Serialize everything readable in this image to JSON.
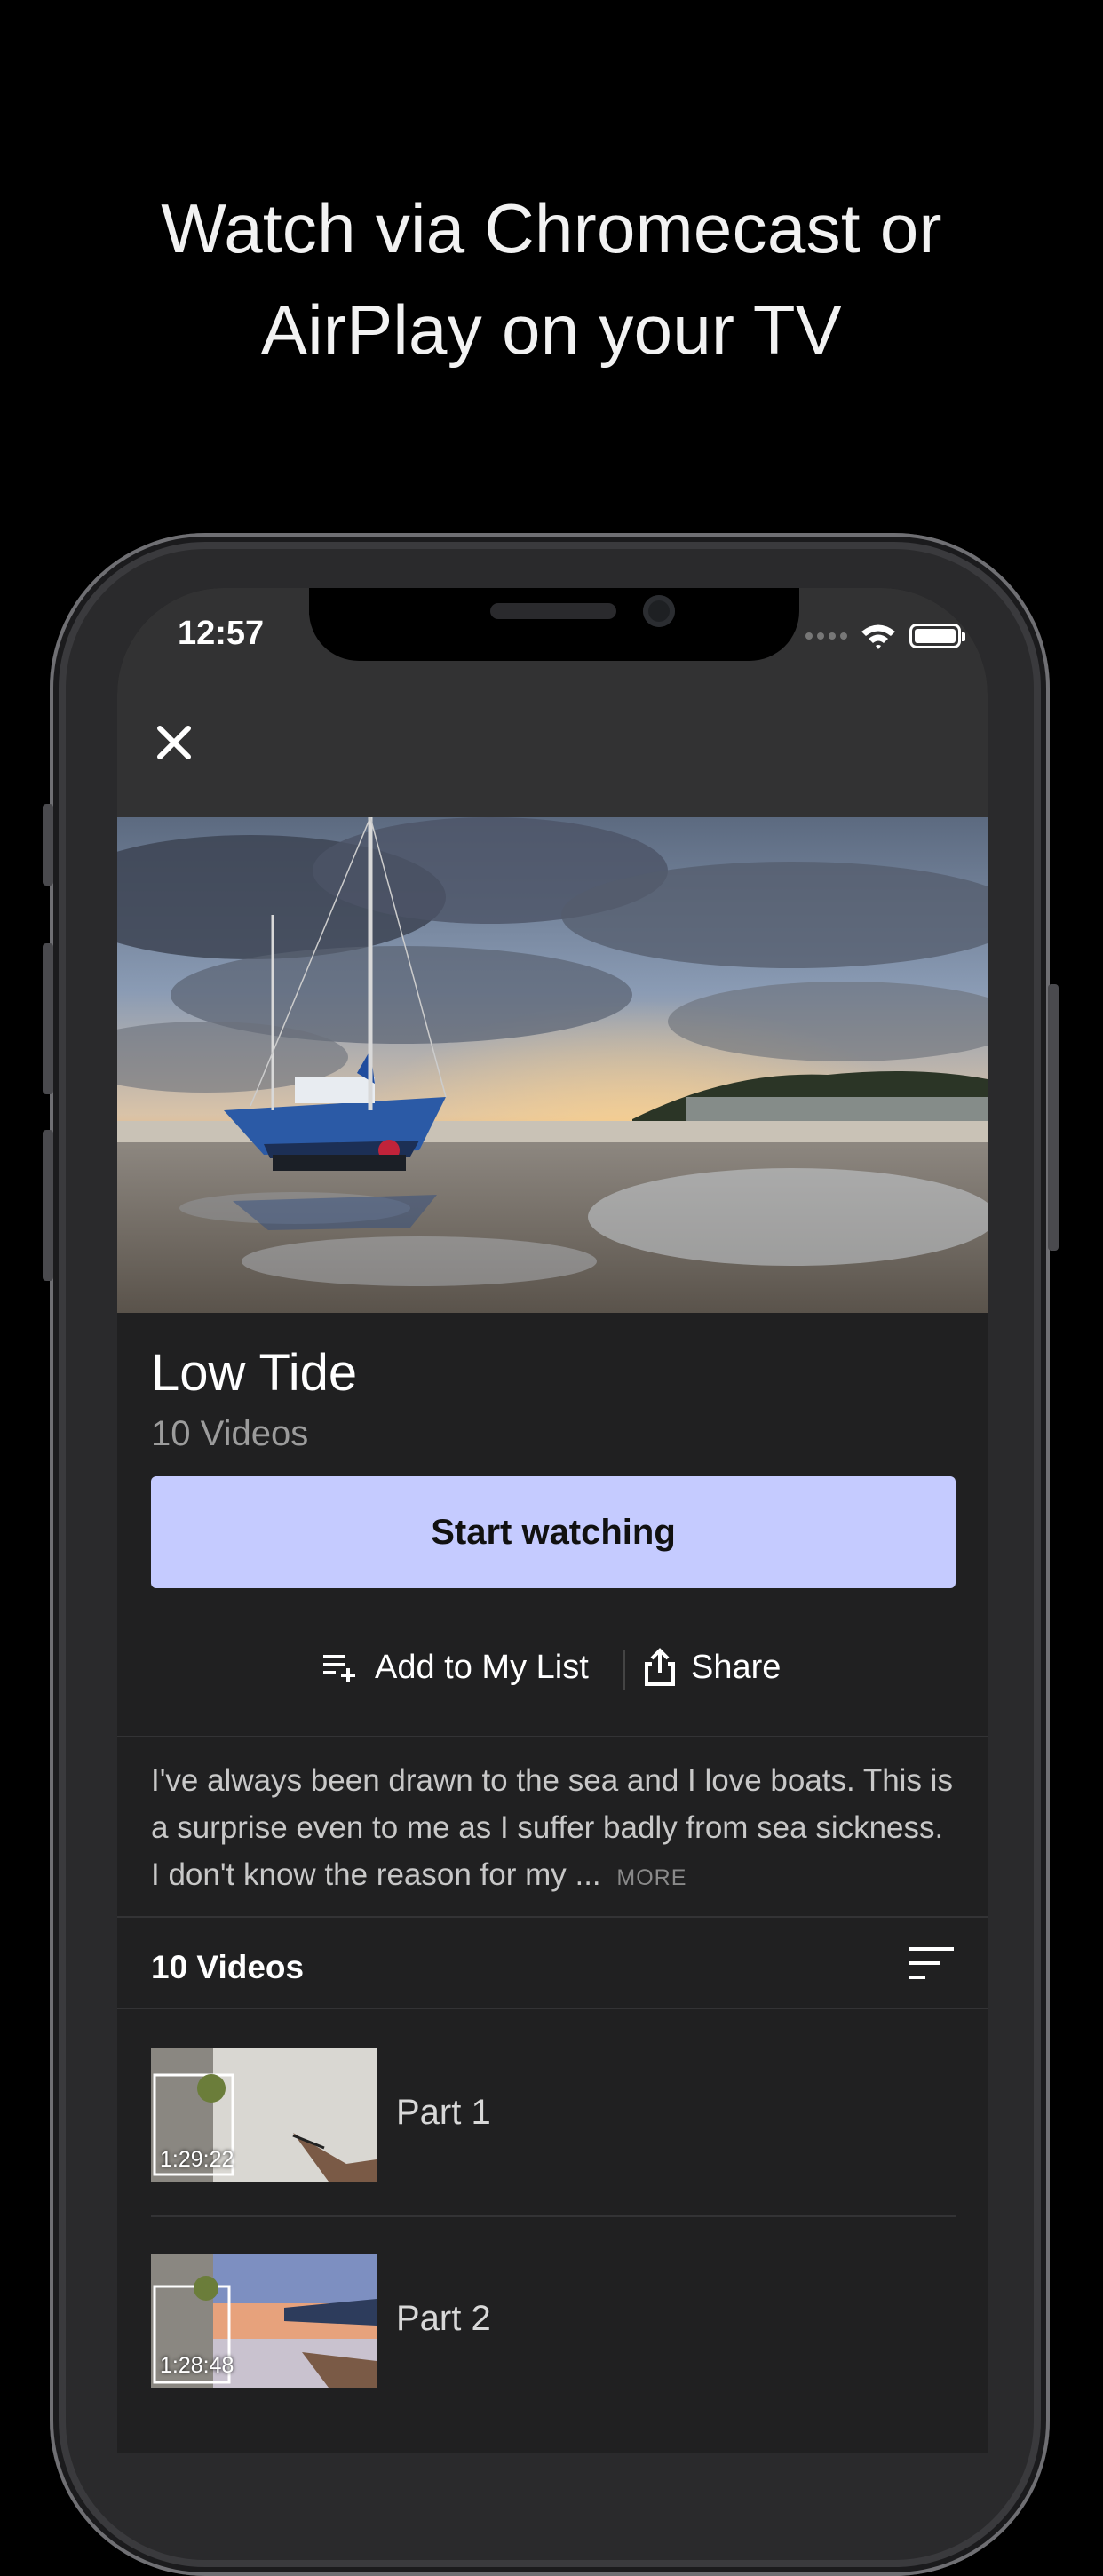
{
  "headline": {
    "line1": "Watch via Chromecast or",
    "line2": "AirPlay on your TV"
  },
  "status_bar": {
    "time": "12:57"
  },
  "collection": {
    "title": "Low Tide",
    "count_label": "10 Videos",
    "primary_button": "Start watching",
    "add_to_list": "Add to My List",
    "share": "Share",
    "description": "I've always been drawn to the sea and I love boats. This is a surprise even to me as I suffer badly from sea sickness. I don't know the reason for my ...",
    "more_link": "MORE"
  },
  "video_list": {
    "header": "10 Videos",
    "items": [
      {
        "label": "Part 1",
        "duration": "1:29:22"
      },
      {
        "label": "Part 2",
        "duration": "1:28:48"
      }
    ]
  },
  "colors": {
    "accent": "#c5cbff",
    "background": "#202021",
    "nav": "#323233"
  },
  "icons": [
    "close-icon",
    "wifi-icon",
    "battery-icon",
    "playlist-add-icon",
    "share-icon",
    "sort-icon"
  ]
}
